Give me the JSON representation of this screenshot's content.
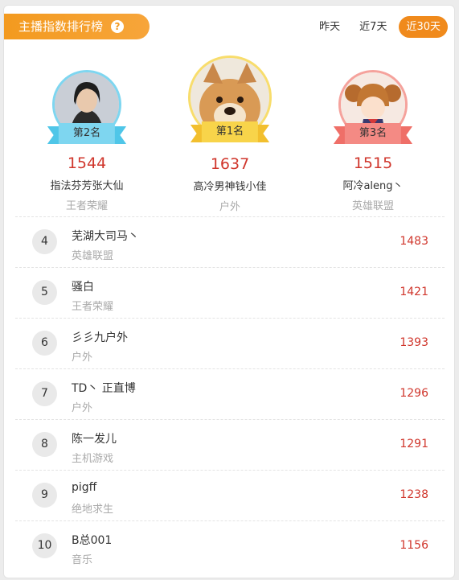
{
  "header": {
    "title": "主播指数排行榜",
    "help_icon": "?"
  },
  "range_tabs": [
    {
      "label": "昨天",
      "active": false
    },
    {
      "label": "近7天",
      "active": false
    },
    {
      "label": "近30天",
      "active": true
    }
  ],
  "top3": [
    {
      "rank_label": "第2名",
      "score": "1544",
      "name": "指法芬芳张大仙",
      "category": "王者荣耀",
      "color": "#7ed6f0"
    },
    {
      "rank_label": "第1名",
      "score": "1637",
      "name": "高冷男神钱小佳",
      "category": "户外",
      "color": "#f8d44a"
    },
    {
      "rank_label": "第3名",
      "score": "1515",
      "name": "阿冷aleng丶",
      "category": "英雄联盟",
      "color": "#f48a84"
    }
  ],
  "ranking": [
    {
      "rank": "4",
      "name": "芜湖大司马丶",
      "category": "英雄联盟",
      "score": "1483"
    },
    {
      "rank": "5",
      "name": "骚白",
      "category": "王者荣耀",
      "score": "1421"
    },
    {
      "rank": "6",
      "name": "彡彡九户外",
      "category": "户外",
      "score": "1393"
    },
    {
      "rank": "7",
      "name": "TD丶 正直博",
      "category": "户外",
      "score": "1296"
    },
    {
      "rank": "8",
      "name": "陈一发儿",
      "category": "主机游戏",
      "score": "1291"
    },
    {
      "rank": "9",
      "name": "pigff",
      "category": "绝地求生",
      "score": "1238"
    },
    {
      "rank": "10",
      "name": "B总001",
      "category": "音乐",
      "score": "1156"
    }
  ]
}
